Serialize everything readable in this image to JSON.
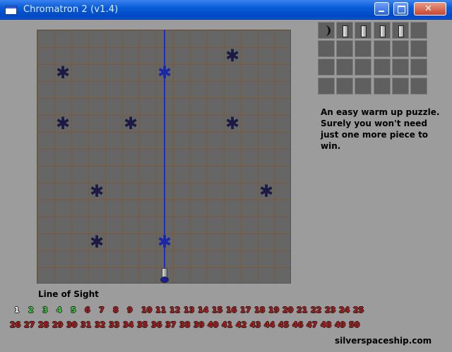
{
  "window": {
    "title": "Chromatron 2 (v1.4)"
  },
  "palette": {
    "pieces": [
      "curve-mirror-piece",
      "straight-mirror-piece",
      "straight-mirror-piece",
      "straight-mirror-piece",
      "straight-mirror-piece"
    ]
  },
  "hint": "An easy warm up puzzle. Surely you won't need just one more piece to win.",
  "level_name": "Line of Sight",
  "levels": [
    "1",
    "2",
    "3",
    "4",
    "5",
    "6",
    "7",
    "8",
    "9",
    "10",
    "11",
    "12",
    "13",
    "14",
    "15",
    "16",
    "17",
    "18",
    "19",
    "20",
    "21",
    "22",
    "23",
    "24",
    "25",
    "26",
    "27",
    "28",
    "29",
    "30",
    "31",
    "32",
    "33",
    "34",
    "35",
    "36",
    "37",
    "38",
    "39",
    "40",
    "41",
    "42",
    "43",
    "44",
    "45",
    "46",
    "47",
    "48",
    "49",
    "50"
  ],
  "levels_completed": [
    "2",
    "3",
    "4",
    "5"
  ],
  "current_level": "1",
  "website": "silverspaceship.com",
  "colors": {
    "beam": "#1e2ec8",
    "target": "#1a1a44",
    "level_done": "#3ed33e",
    "level_locked": "#b81818"
  }
}
